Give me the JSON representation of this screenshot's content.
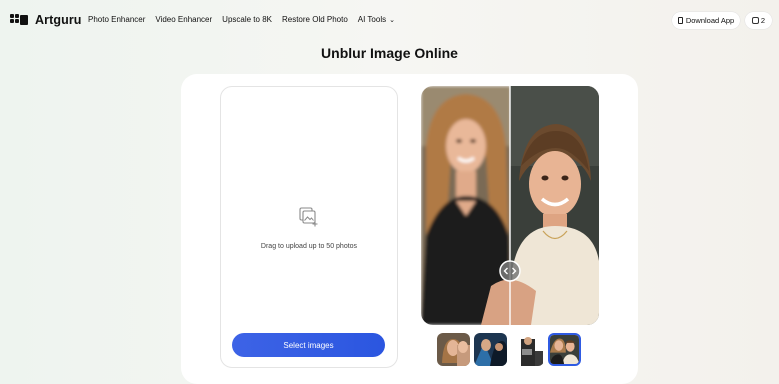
{
  "brand": {
    "name": "Artguru",
    "logo_icon": "artguru-logo-icon"
  },
  "nav": {
    "items": [
      {
        "label": "Photo Enhancer"
      },
      {
        "label": "Video Enhancer"
      },
      {
        "label": "Upscale to 8K"
      },
      {
        "label": "Restore Old Photo"
      },
      {
        "label": "AI Tools"
      }
    ],
    "dropdown_icon": "chevron-down-icon"
  },
  "header_actions": {
    "download_label": "Download App",
    "download_icon": "phone-icon",
    "credits_count": "2",
    "credits_icon": "coin-icon"
  },
  "page": {
    "title": "Unblur Image Online"
  },
  "upload": {
    "icon": "add-image-icon",
    "hint": "Drag to upload up to 50 photos",
    "button_label": "Select images"
  },
  "preview": {
    "slider_icon": "compare-handle-icon",
    "description": "before-after comparison photo"
  },
  "thumbnails": {
    "count": 4,
    "selected_index": 3
  },
  "colors": {
    "accent": "#2f5be3",
    "background": "#f3f4f0",
    "card": "#ffffff"
  }
}
